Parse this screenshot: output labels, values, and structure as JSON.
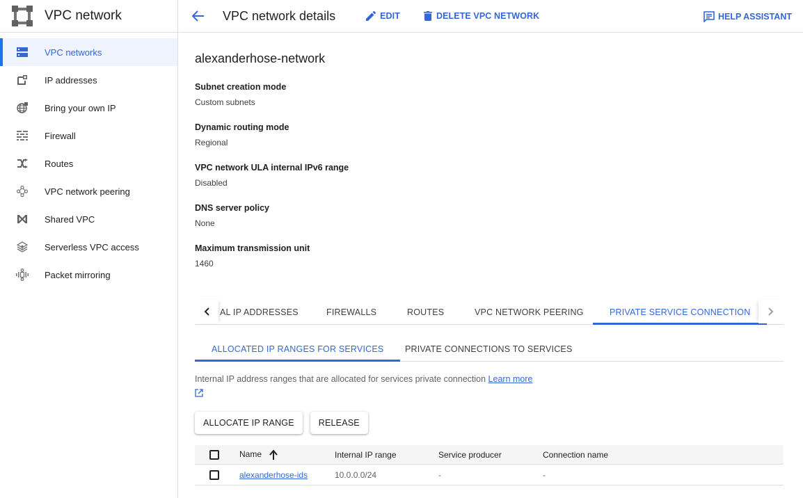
{
  "sidebar": {
    "title": "VPC network",
    "items": [
      {
        "label": "VPC networks",
        "icon": "vpc-networks-icon",
        "active": true
      },
      {
        "label": "IP addresses",
        "icon": "ip-addresses-icon"
      },
      {
        "label": "Bring your own IP",
        "icon": "globe-icon"
      },
      {
        "label": "Firewall",
        "icon": "firewall-icon"
      },
      {
        "label": "Routes",
        "icon": "routes-icon"
      },
      {
        "label": "VPC network peering",
        "icon": "peering-icon"
      },
      {
        "label": "Shared VPC",
        "icon": "shared-vpc-icon"
      },
      {
        "label": "Serverless VPC access",
        "icon": "serverless-icon"
      },
      {
        "label": "Packet mirroring",
        "icon": "packet-mirroring-icon"
      }
    ]
  },
  "header": {
    "title": "VPC network details",
    "edit_label": "EDIT",
    "delete_label": "DELETE VPC NETWORK",
    "help_label": "HELP ASSISTANT"
  },
  "network": {
    "name": "alexanderhose-network",
    "fields": [
      {
        "label": "Subnet creation mode",
        "value": "Custom subnets"
      },
      {
        "label": "Dynamic routing mode",
        "value": "Regional"
      },
      {
        "label": "VPC network ULA internal IPv6 range",
        "value": "Disabled"
      },
      {
        "label": "DNS server policy",
        "value": "None"
      },
      {
        "label": "Maximum transmission unit",
        "value": "1460"
      }
    ]
  },
  "tabs": [
    {
      "label": "AL IP ADDRESSES"
    },
    {
      "label": "FIREWALLS"
    },
    {
      "label": "ROUTES"
    },
    {
      "label": "VPC NETWORK PEERING"
    },
    {
      "label": "PRIVATE SERVICE CONNECTION",
      "active": true
    }
  ],
  "subtabs": [
    {
      "label": "ALLOCATED IP RANGES FOR SERVICES",
      "active": true
    },
    {
      "label": "PRIVATE CONNECTIONS TO SERVICES"
    }
  ],
  "description": {
    "text": "Internal IP address ranges that are allocated for services private connection ",
    "link": "Learn more"
  },
  "actions": {
    "allocate_label": "ALLOCATE IP RANGE",
    "release_label": "RELEASE"
  },
  "table": {
    "columns": [
      "Name",
      "Internal IP range",
      "Service producer",
      "Connection name"
    ],
    "rows": [
      {
        "name": "alexanderhose-ids",
        "ip_range": "10.0.0.0/24",
        "service_producer": "-",
        "connection_name": "-"
      }
    ]
  },
  "colors": {
    "accent": "#3367d6",
    "active_bg": "#eef3fd",
    "border": "#dadce0"
  }
}
